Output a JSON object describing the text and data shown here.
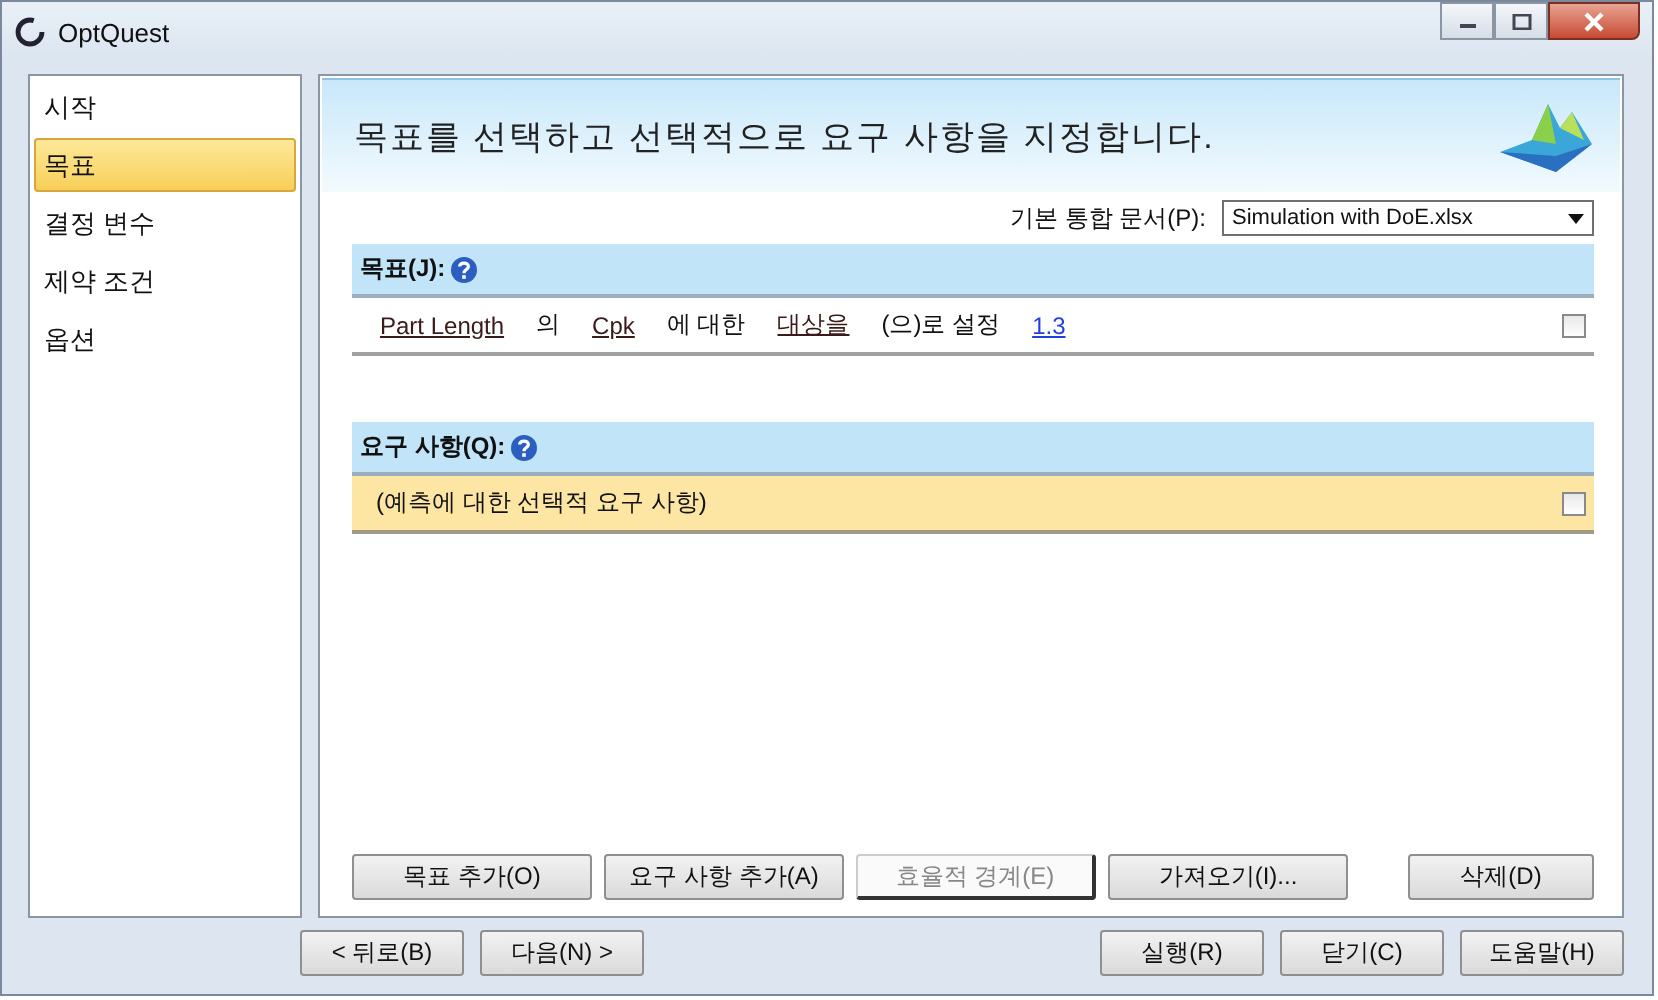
{
  "window": {
    "title": "OptQuest"
  },
  "sidebar": {
    "items": [
      {
        "label": "시작",
        "selected": false
      },
      {
        "label": "목표",
        "selected": true
      },
      {
        "label": "결정 변수",
        "selected": false
      },
      {
        "label": "제약 조건",
        "selected": false
      },
      {
        "label": "옵션",
        "selected": false
      }
    ]
  },
  "header": {
    "title": "목표를 선택하고 선택적으로 요구 사항을 지정합니다."
  },
  "workbook": {
    "label": "기본 통합 문서(P):",
    "value": "Simulation with DoE.xlsx"
  },
  "objectives": {
    "title": "목표(J):",
    "rows": [
      {
        "checked": false,
        "parts": [
          {
            "kind": "link",
            "text": "Part Length"
          },
          {
            "kind": "text",
            "text": "의"
          },
          {
            "kind": "link",
            "text": "Cpk"
          },
          {
            "kind": "text",
            "text": "에 대한"
          },
          {
            "kind": "link",
            "text": "대상을"
          },
          {
            "kind": "text",
            "text": "(으)로 설정"
          },
          {
            "kind": "hyperlink",
            "text": "1.3"
          }
        ]
      }
    ]
  },
  "requirements": {
    "title": "요구 사항(Q):",
    "rows": [
      {
        "text": "(예측에 대한 선택적 요구 사항)",
        "checked": false
      }
    ]
  },
  "actions": [
    {
      "label": "목표 추가(O)",
      "disabled": false
    },
    {
      "label": "요구 사항 추가(A)",
      "disabled": false
    },
    {
      "label": "효율적 경계(E)",
      "disabled": true
    },
    {
      "label": "가져오기(I)...",
      "disabled": false
    },
    {
      "label": "삭제(D)",
      "disabled": false
    }
  ],
  "nav": [
    {
      "label": "< 뒤로(B)"
    },
    {
      "label": "다음(N) >"
    }
  ],
  "footer": [
    {
      "label": "실행(R)"
    },
    {
      "label": "닫기(C)"
    },
    {
      "label": "도움말(H)"
    }
  ]
}
